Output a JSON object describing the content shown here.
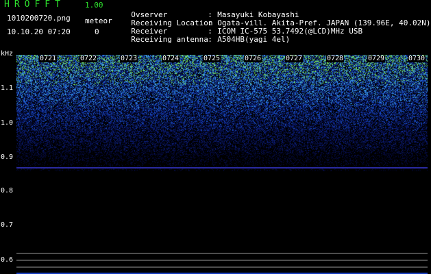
{
  "header": {
    "app_title": "HROFFT",
    "app_version": "1.00",
    "file_name": "1010200720.png",
    "meteor_label": "meteor",
    "date_time": "10.10.20 07:20",
    "meteor_count": "0"
  },
  "info": [
    {
      "key": "Ovserver",
      "value": "Masayuki Kobayashi"
    },
    {
      "key": "Receiving Location",
      "value": "Ogata-vill. Akita-Pref. JAPAN (139.96E, 40.02N)"
    },
    {
      "key": "Receiver",
      "value": "ICOM IC-575 53.7492(@LCD)MHz USB"
    },
    {
      "key": "Receiving antenna",
      "value": "A504HB(yagi 4el)"
    }
  ],
  "plot": {
    "y_unit": "kHz",
    "y_ticks": [
      "1.1",
      "1.0",
      "0.9",
      "0.8",
      "0.7",
      "0.6"
    ],
    "x_ticks": [
      "0721",
      "0722",
      "0723",
      "0724",
      "0725",
      "0726",
      "0727",
      "0728",
      "0729",
      "0730"
    ],
    "colors": {
      "background": "#000000",
      "spectrum_low": "#0a1a6e",
      "spectrum_mid": "#1f6fd6",
      "spectrum_high": "#7cf04a",
      "baseline": "#2a2aa0",
      "guide_lines": "#9a9a9a",
      "axis_text": "#ffffff"
    }
  }
}
